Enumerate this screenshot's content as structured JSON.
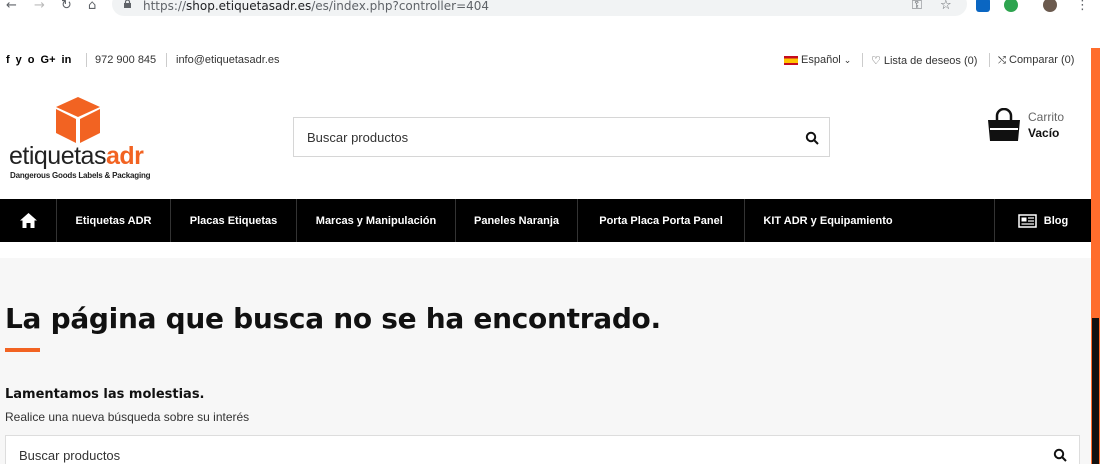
{
  "browser": {
    "url_scheme": "https://",
    "url_host": "shop.etiquetasadr.es",
    "url_path": "/es/index.php?controller=404"
  },
  "topbar": {
    "social": [
      "f",
      "y",
      "o",
      "G+",
      "in"
    ],
    "phone": "972 900 845",
    "email": "info@etiquetasadr.es",
    "language": "Español",
    "wishlist": "Lista de deseos (0)",
    "compare": "Comparar (0)"
  },
  "header": {
    "logo_word_plain": "etiquetas",
    "logo_word_accent": "adr",
    "logo_tagline": "Dangerous Goods Labels & Packaging",
    "search_placeholder": "Buscar productos",
    "cart_label": "Carrito",
    "cart_status": "Vacío"
  },
  "nav": {
    "items": [
      "Etiquetas ADR",
      "Placas Etiquetas",
      "Marcas y Manipulación",
      "Paneles Naranja",
      "Porta Placa Porta Panel",
      "KIT ADR y Equipamiento"
    ],
    "blog": "Blog"
  },
  "main": {
    "title": "La página que busca no se ha encontrado.",
    "sorry": "Lamentamos las molestias.",
    "hint": "Realice una nueva búsqueda sobre su interés",
    "search_placeholder": "Buscar productos"
  },
  "colors": {
    "accent": "#f26322",
    "nav_bg": "#000000",
    "scrollbar": "#ff6d2c"
  }
}
